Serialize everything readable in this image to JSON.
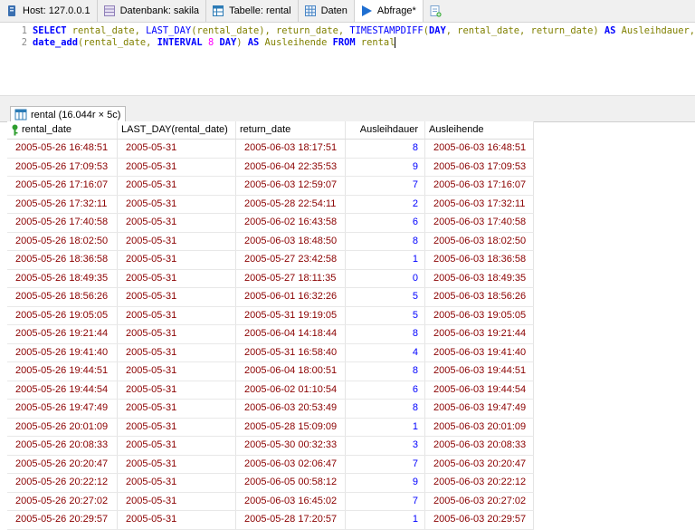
{
  "tabs": [
    {
      "label": "Host: 127.0.0.1",
      "icon": "host-icon"
    },
    {
      "label": "Datenbank: sakila",
      "icon": "database-icon"
    },
    {
      "label": "Tabelle: rental",
      "icon": "table-icon"
    },
    {
      "label": "Daten",
      "icon": "grid-icon"
    },
    {
      "label": "Abfrage*",
      "icon": "play-icon"
    }
  ],
  "editor": {
    "line_numbers": [
      "1",
      "2"
    ],
    "line1": [
      {
        "t": "SELECT",
        "c": "kw"
      },
      {
        "t": " rental_date, ",
        "c": "id"
      },
      {
        "t": "LAST_DAY",
        "c": "fn"
      },
      {
        "t": "(rental_date), return_date, ",
        "c": "id"
      },
      {
        "t": "TIMESTAMPDIFF",
        "c": "fn"
      },
      {
        "t": "(",
        "c": "id"
      },
      {
        "t": "DAY",
        "c": "kw"
      },
      {
        "t": ", rental_date, return_date) ",
        "c": "id"
      },
      {
        "t": "AS",
        "c": "kw"
      },
      {
        "t": " Ausleihdauer,",
        "c": "id"
      }
    ],
    "line2": [
      {
        "t": "date_add",
        "c": "kw"
      },
      {
        "t": "(rental_date, ",
        "c": "id"
      },
      {
        "t": "INTERVAL",
        "c": "kw"
      },
      {
        "t": " ",
        "c": "id"
      },
      {
        "t": "8",
        "c": "num"
      },
      {
        "t": " ",
        "c": "id"
      },
      {
        "t": "DAY",
        "c": "kw"
      },
      {
        "t": ") ",
        "c": "id"
      },
      {
        "t": "AS",
        "c": "kw"
      },
      {
        "t": " Ausleihende ",
        "c": "id"
      },
      {
        "t": "FROM",
        "c": "kw"
      },
      {
        "t": " rental",
        "c": "id"
      }
    ]
  },
  "result_tab": {
    "label": "rental (16.044r × 5c)"
  },
  "grid": {
    "columns": [
      "rental_date",
      "LAST_DAY(rental_date)",
      "return_date",
      "Ausleihdauer",
      "Ausleihende"
    ],
    "rows": [
      [
        "2005-05-26 16:48:51",
        "2005-05-31",
        "2005-06-03 18:17:51",
        "8",
        "2005-06-03 16:48:51"
      ],
      [
        "2005-05-26 17:09:53",
        "2005-05-31",
        "2005-06-04 22:35:53",
        "9",
        "2005-06-03 17:09:53"
      ],
      [
        "2005-05-26 17:16:07",
        "2005-05-31",
        "2005-06-03 12:59:07",
        "7",
        "2005-06-03 17:16:07"
      ],
      [
        "2005-05-26 17:32:11",
        "2005-05-31",
        "2005-05-28 22:54:11",
        "2",
        "2005-06-03 17:32:11"
      ],
      [
        "2005-05-26 17:40:58",
        "2005-05-31",
        "2005-06-02 16:43:58",
        "6",
        "2005-06-03 17:40:58"
      ],
      [
        "2005-05-26 18:02:50",
        "2005-05-31",
        "2005-06-03 18:48:50",
        "8",
        "2005-06-03 18:02:50"
      ],
      [
        "2005-05-26 18:36:58",
        "2005-05-31",
        "2005-05-27 23:42:58",
        "1",
        "2005-06-03 18:36:58"
      ],
      [
        "2005-05-26 18:49:35",
        "2005-05-31",
        "2005-05-27 18:11:35",
        "0",
        "2005-06-03 18:49:35"
      ],
      [
        "2005-05-26 18:56:26",
        "2005-05-31",
        "2005-06-01 16:32:26",
        "5",
        "2005-06-03 18:56:26"
      ],
      [
        "2005-05-26 19:05:05",
        "2005-05-31",
        "2005-05-31 19:19:05",
        "5",
        "2005-06-03 19:05:05"
      ],
      [
        "2005-05-26 19:21:44",
        "2005-05-31",
        "2005-06-04 14:18:44",
        "8",
        "2005-06-03 19:21:44"
      ],
      [
        "2005-05-26 19:41:40",
        "2005-05-31",
        "2005-05-31 16:58:40",
        "4",
        "2005-06-03 19:41:40"
      ],
      [
        "2005-05-26 19:44:51",
        "2005-05-31",
        "2005-06-04 18:00:51",
        "8",
        "2005-06-03 19:44:51"
      ],
      [
        "2005-05-26 19:44:54",
        "2005-05-31",
        "2005-06-02 01:10:54",
        "6",
        "2005-06-03 19:44:54"
      ],
      [
        "2005-05-26 19:47:49",
        "2005-05-31",
        "2005-06-03 20:53:49",
        "8",
        "2005-06-03 19:47:49"
      ],
      [
        "2005-05-26 20:01:09",
        "2005-05-31",
        "2005-05-28 15:09:09",
        "1",
        "2005-06-03 20:01:09"
      ],
      [
        "2005-05-26 20:08:33",
        "2005-05-31",
        "2005-05-30 00:32:33",
        "3",
        "2005-06-03 20:08:33"
      ],
      [
        "2005-05-26 20:20:47",
        "2005-05-31",
        "2005-06-03 02:06:47",
        "7",
        "2005-06-03 20:20:47"
      ],
      [
        "2005-05-26 20:22:12",
        "2005-05-31",
        "2005-06-05 00:58:12",
        "9",
        "2005-06-03 20:22:12"
      ],
      [
        "2005-05-26 20:27:02",
        "2005-05-31",
        "2005-06-03 16:45:02",
        "7",
        "2005-06-03 20:27:02"
      ],
      [
        "2005-05-26 20:29:57",
        "2005-05-31",
        "2005-05-28 17:20:57",
        "1",
        "2005-06-03 20:29:57"
      ]
    ]
  },
  "colors": {
    "keyword": "#0000ff",
    "identifier": "#808000",
    "number": "#ff00ff",
    "date_cell": "#8b0000",
    "int_cell": "#0000ff",
    "key_icon": "#2e9e2e"
  }
}
